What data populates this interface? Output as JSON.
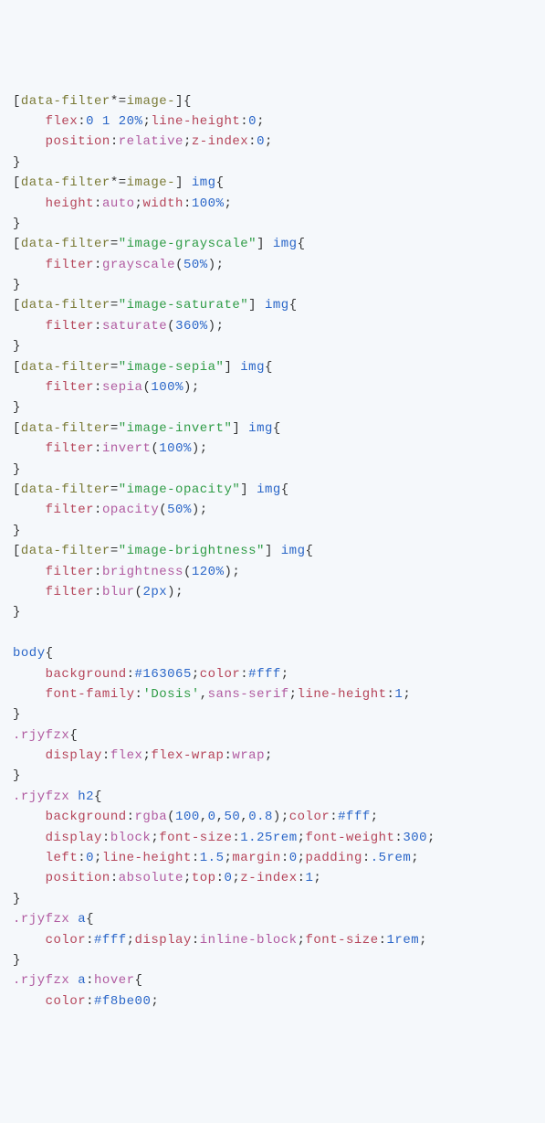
{
  "lines": [
    {
      "html": "<span class='punct'>[</span><span class='sel'>data-filter</span><span class='punct'>*=</span><span class='sel'>image-</span><span class='punct'>]{</span>"
    },
    {
      "html": "    <span class='prop'>flex</span><span class='punct'>:</span><span class='num'>0 1 20%</span><span class='punct'>;</span><span class='prop'>line-height</span><span class='punct'>:</span><span class='num'>0</span><span class='punct'>;</span>"
    },
    {
      "html": "    <span class='prop'>position</span><span class='punct'>:</span><span class='kw'>relative</span><span class='punct'>;</span><span class='prop'>z-index</span><span class='punct'>:</span><span class='num'>0</span><span class='punct'>;</span>"
    },
    {
      "html": "<span class='punct'>}</span>"
    },
    {
      "html": "<span class='punct'>[</span><span class='sel'>data-filter</span><span class='punct'>*=</span><span class='sel'>image-</span><span class='punct'>]</span> <span class='tag'>img</span><span class='punct'>{</span>"
    },
    {
      "html": "    <span class='prop'>height</span><span class='punct'>:</span><span class='kw'>auto</span><span class='punct'>;</span><span class='prop'>width</span><span class='punct'>:</span><span class='num'>100%</span><span class='punct'>;</span>"
    },
    {
      "html": "<span class='punct'>}</span>"
    },
    {
      "html": "<span class='punct'>[</span><span class='sel'>data-filter</span><span class='punct'>=</span><span class='str'>\"image-grayscale\"</span><span class='punct'>]</span> <span class='tag'>img</span><span class='punct'>{</span>"
    },
    {
      "html": "    <span class='prop'>filter</span><span class='punct'>:</span><span class='fn'>grayscale</span><span class='punct'>(</span><span class='num'>50%</span><span class='punct'>);</span>"
    },
    {
      "html": "<span class='punct'>}</span>"
    },
    {
      "html": "<span class='punct'>[</span><span class='sel'>data-filter</span><span class='punct'>=</span><span class='str'>\"image-saturate\"</span><span class='punct'>]</span> <span class='tag'>img</span><span class='punct'>{</span>"
    },
    {
      "html": "    <span class='prop'>filter</span><span class='punct'>:</span><span class='fn'>saturate</span><span class='punct'>(</span><span class='num'>360%</span><span class='punct'>);</span>"
    },
    {
      "html": "<span class='punct'>}</span>"
    },
    {
      "html": "<span class='punct'>[</span><span class='sel'>data-filter</span><span class='punct'>=</span><span class='str'>\"image-sepia\"</span><span class='punct'>]</span> <span class='tag'>img</span><span class='punct'>{</span>"
    },
    {
      "html": "    <span class='prop'>filter</span><span class='punct'>:</span><span class='fn'>sepia</span><span class='punct'>(</span><span class='num'>100%</span><span class='punct'>);</span>"
    },
    {
      "html": "<span class='punct'>}</span>"
    },
    {
      "html": "<span class='punct'>[</span><span class='sel'>data-filter</span><span class='punct'>=</span><span class='str'>\"image-invert\"</span><span class='punct'>]</span> <span class='tag'>img</span><span class='punct'>{</span>"
    },
    {
      "html": "    <span class='prop'>filter</span><span class='punct'>:</span><span class='fn'>invert</span><span class='punct'>(</span><span class='num'>100%</span><span class='punct'>);</span>"
    },
    {
      "html": "<span class='punct'>}</span>"
    },
    {
      "html": "<span class='punct'>[</span><span class='sel'>data-filter</span><span class='punct'>=</span><span class='str'>\"image-opacity\"</span><span class='punct'>]</span> <span class='tag'>img</span><span class='punct'>{</span>"
    },
    {
      "html": "    <span class='prop'>filter</span><span class='punct'>:</span><span class='fn'>opacity</span><span class='punct'>(</span><span class='num'>50%</span><span class='punct'>);</span>"
    },
    {
      "html": "<span class='punct'>}</span>"
    },
    {
      "html": "<span class='punct'>[</span><span class='sel'>data-filter</span><span class='punct'>=</span><span class='str'>\"image-brightness\"</span><span class='punct'>]</span> <span class='tag'>img</span><span class='punct'>{</span>"
    },
    {
      "html": "    <span class='prop'>filter</span><span class='punct'>:</span><span class='fn'>brightness</span><span class='punct'>(</span><span class='num'>120%</span><span class='punct'>);</span>"
    },
    {
      "html": "    <span class='prop'>filter</span><span class='punct'>:</span><span class='fn'>blur</span><span class='punct'>(</span><span class='num'>2px</span><span class='punct'>);</span>"
    },
    {
      "html": "<span class='punct'>}</span>"
    },
    {
      "html": ""
    },
    {
      "html": "<span class='tag'>body</span><span class='punct'>{</span>"
    },
    {
      "html": "    <span class='prop'>background</span><span class='punct'>:</span><span class='hex'>#163065</span><span class='punct'>;</span><span class='prop'>color</span><span class='punct'>:</span><span class='hex'>#fff</span><span class='punct'>;</span>"
    },
    {
      "html": "    <span class='prop'>font-family</span><span class='punct'>:</span><span class='str'>'Dosis'</span><span class='punct'>,</span><span class='kw'>sans-serif</span><span class='punct'>;</span><span class='prop'>line-height</span><span class='punct'>:</span><span class='num'>1</span><span class='punct'>;</span>"
    },
    {
      "html": "<span class='punct'>}</span>"
    },
    {
      "html": "<span class='cls'>.rjyfzx</span><span class='punct'>{</span>"
    },
    {
      "html": "    <span class='prop'>display</span><span class='punct'>:</span><span class='kw'>flex</span><span class='punct'>;</span><span class='prop'>flex-wrap</span><span class='punct'>:</span><span class='kw'>wrap</span><span class='punct'>;</span>"
    },
    {
      "html": "<span class='punct'>}</span>"
    },
    {
      "html": "<span class='cls'>.rjyfzx</span> <span class='tag'>h2</span><span class='punct'>{</span>"
    },
    {
      "html": "    <span class='prop'>background</span><span class='punct'>:</span><span class='fn'>rgba</span><span class='punct'>(</span><span class='num'>100</span><span class='punct'>,</span><span class='num'>0</span><span class='punct'>,</span><span class='num'>50</span><span class='punct'>,</span><span class='num'>0.8</span><span class='punct'>);</span><span class='prop'>color</span><span class='punct'>:</span><span class='hex'>#fff</span><span class='punct'>;</span>"
    },
    {
      "html": "    <span class='prop'>display</span><span class='punct'>:</span><span class='kw'>block</span><span class='punct'>;</span><span class='prop'>font-size</span><span class='punct'>:</span><span class='num'>1.25rem</span><span class='punct'>;</span><span class='prop'>font-weight</span><span class='punct'>:</span><span class='num'>300</span><span class='punct'>;</span>"
    },
    {
      "html": "    <span class='prop'>left</span><span class='punct'>:</span><span class='num'>0</span><span class='punct'>;</span><span class='prop'>line-height</span><span class='punct'>:</span><span class='num'>1.5</span><span class='punct'>;</span><span class='prop'>margin</span><span class='punct'>:</span><span class='num'>0</span><span class='punct'>;</span><span class='prop'>padding</span><span class='punct'>:</span><span class='num'>.5rem</span><span class='punct'>;</span>"
    },
    {
      "html": "    <span class='prop'>position</span><span class='punct'>:</span><span class='kw'>absolute</span><span class='punct'>;</span><span class='prop'>top</span><span class='punct'>:</span><span class='num'>0</span><span class='punct'>;</span><span class='prop'>z-index</span><span class='punct'>:</span><span class='num'>1</span><span class='punct'>;</span>"
    },
    {
      "html": "<span class='punct'>}</span>"
    },
    {
      "html": "<span class='cls'>.rjyfzx</span> <span class='tag'>a</span><span class='punct'>{</span>"
    },
    {
      "html": "    <span class='prop'>color</span><span class='punct'>:</span><span class='hex'>#fff</span><span class='punct'>;</span><span class='prop'>display</span><span class='punct'>:</span><span class='kw'>inline-block</span><span class='punct'>;</span><span class='prop'>font-size</span><span class='punct'>:</span><span class='num'>1rem</span><span class='punct'>;</span>"
    },
    {
      "html": "<span class='punct'>}</span>"
    },
    {
      "html": "<span class='cls'>.rjyfzx</span> <span class='tag'>a</span><span class='punct'>:</span><span class='kw'>hover</span><span class='punct'>{</span>"
    },
    {
      "html": "    <span class='prop'>color</span><span class='punct'>:</span><span class='hex'>#f8be00</span><span class='punct'>;</span>"
    }
  ]
}
